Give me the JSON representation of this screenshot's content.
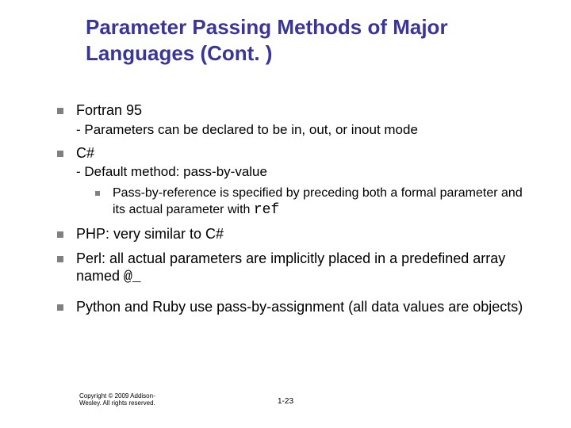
{
  "title": "Parameter Passing Methods of Major Languages (Cont. )",
  "b1": "Fortran 95",
  "b1sub": "- Parameters can be declared to be in, out, or inout mode",
  "b2": "C#",
  "b2sub_prefix": "- ",
  "b2sub": "Default method: pass-by-value",
  "b2ref_pre": "Pass-by-reference is specified by preceding both a formal parameter and its actual parameter with ",
  "b2ref_code": "ref",
  "b3": "PHP: very similar to C#",
  "b4_pre": "Perl: all actual parameters are implicitly placed in a predefined array named ",
  "b4_code": "@_",
  "b5": "Python and Ruby use pass-by-assignment (all data values are objects)",
  "copyright_l1": "Copyright © 2009 Addison-",
  "copyright_l2": "Wesley. All rights reserved.",
  "page_num": "1-23"
}
